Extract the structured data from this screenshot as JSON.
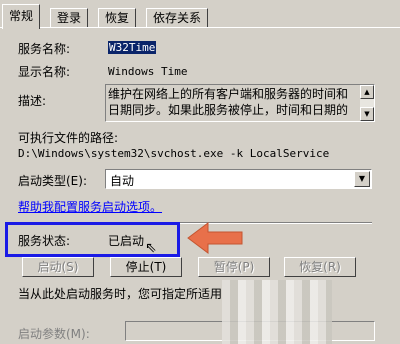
{
  "tabs": [
    "常规",
    "登录",
    "恢复",
    "依存关系"
  ],
  "general": {
    "service_name_label": "服务名称:",
    "service_name_value": "W32Time",
    "display_name_label": "显示名称:",
    "display_name_value": "Windows Time",
    "description_label": "描述:",
    "description_value": "维护在网络上的所有客户端和服务器的时间和日期同步。如果此服务被停止，时间和日期的",
    "exec_path_label": "可执行文件的路径:",
    "exec_path_value": "D:\\Windows\\system32\\svchost.exe -k LocalService",
    "startup_type_label": "启动类型(E):",
    "startup_type_value": "自动",
    "help_link": "帮助我配置服务启动选项。",
    "status_label": "服务状态:",
    "status_value": "已启动",
    "buttons": {
      "start": "启动(S)",
      "stop": "停止(T)",
      "pause": "暂停(P)",
      "resume": "恢复(R)"
    },
    "start_params_hint": "当从此处启动服务时，您可指定所适用",
    "start_params_label": "启动参数(M):"
  },
  "colors": {
    "highlight_frame": "#1a1ae6",
    "arrow": "#e8704a",
    "link": "#0000ff"
  }
}
